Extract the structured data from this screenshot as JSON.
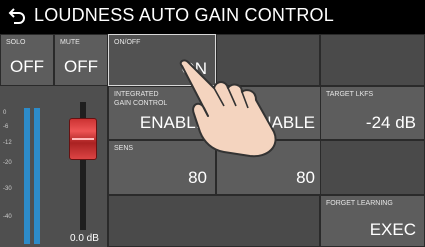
{
  "header": {
    "title": "LOUDNESS AUTO GAIN CONTROL"
  },
  "solo": {
    "label": "SOLO",
    "value": "OFF"
  },
  "mute": {
    "label": "MUTE",
    "value": "OFF"
  },
  "onoff": {
    "label": "ON/OFF",
    "value": "ON"
  },
  "target_lkfs": {
    "label": "TARGET LKFS",
    "value": "-24 dB"
  },
  "integrated": {
    "label": "INTEGRATED\nGAIN CONTROL",
    "value": "ENABLE"
  },
  "second_enable": {
    "label": "",
    "value": "ENABLE"
  },
  "sens": {
    "label": "SENS",
    "value": "80"
  },
  "second_80": {
    "label": "",
    "value": "80"
  },
  "forget": {
    "label": "FORGET LEARNING",
    "value": "EXEC"
  },
  "fader": {
    "value": "0.0 dB",
    "scale": [
      "0",
      "-6",
      "-12",
      "-20",
      "-30",
      "-40"
    ]
  }
}
